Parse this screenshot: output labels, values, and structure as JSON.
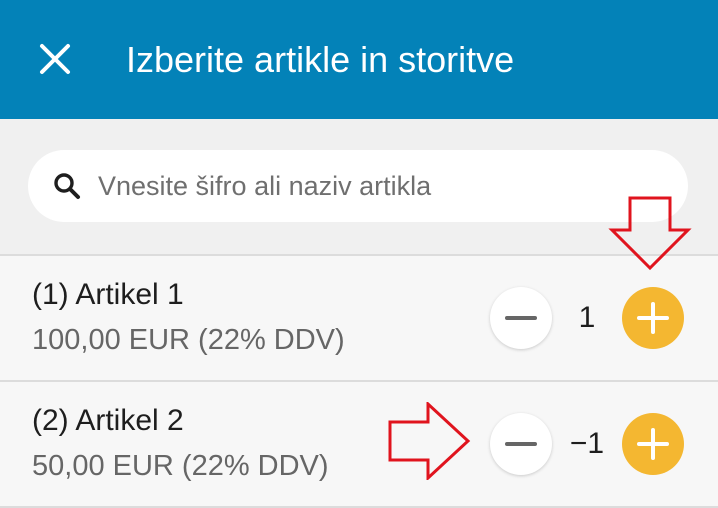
{
  "header": {
    "title": "Izberite artikle in storitve",
    "close_icon": "close-icon",
    "background_color": "#0382b8"
  },
  "search": {
    "placeholder": "Vnesite šifro ali naziv artikla",
    "value": "",
    "icon": "search-icon"
  },
  "items": [
    {
      "name": "(1) Artikel 1",
      "price": "100,00 EUR (22% DDV)",
      "quantity": "1"
    },
    {
      "name": "(2) Artikel 2",
      "price": "50,00 EUR (22% DDV)",
      "quantity": "−1"
    }
  ],
  "colors": {
    "plus_button": "#f4b731",
    "minus_button": "#ffffff",
    "annotation_arrow": "#e0141e"
  }
}
